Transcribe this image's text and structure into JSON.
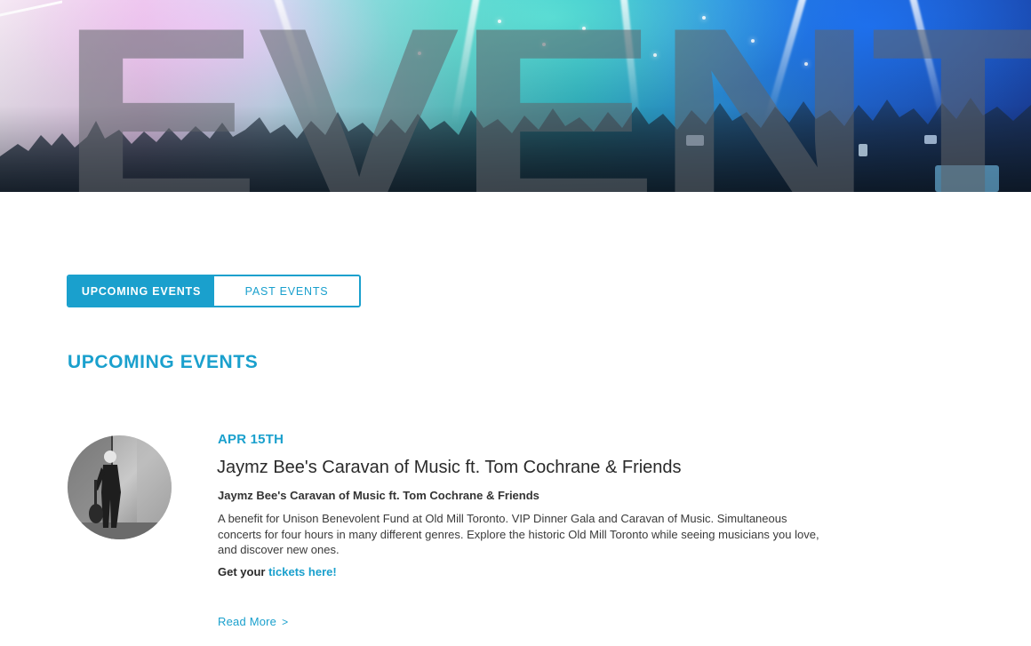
{
  "hero": {
    "title": "EVENTS",
    "image_description": "concert crowd with stage lights"
  },
  "tabs": [
    {
      "label": "UPCOMING EVENTS",
      "active": true
    },
    {
      "label": "PAST EVENTS",
      "active": false
    }
  ],
  "section": {
    "heading": "UPCOMING EVENTS"
  },
  "events": [
    {
      "date": "APR 15TH",
      "title": "Jaymz Bee's Caravan of Music ft. Tom Cochrane & Friends",
      "subtitle": "Jaymz Bee's Caravan of Music ft. Tom Cochrane & Friends",
      "description": "A benefit for Unison Benevolent Fund at Old Mill Toronto. VIP Dinner Gala and Caravan of Music. Simultaneous concerts for four hours in many different genres. Explore the historic Old Mill Toronto while seeing musicians you love, and discover new ones.",
      "tickets_prefix": "Get your",
      "tickets_link": "tickets here!",
      "read_more": "Read More",
      "read_more_chevron": ">",
      "photo_icon": "musician-photo"
    }
  ],
  "colors": {
    "accent": "#1aa0cd",
    "text_dark": "#2a2a2a",
    "text_body": "#3a3a3a"
  }
}
